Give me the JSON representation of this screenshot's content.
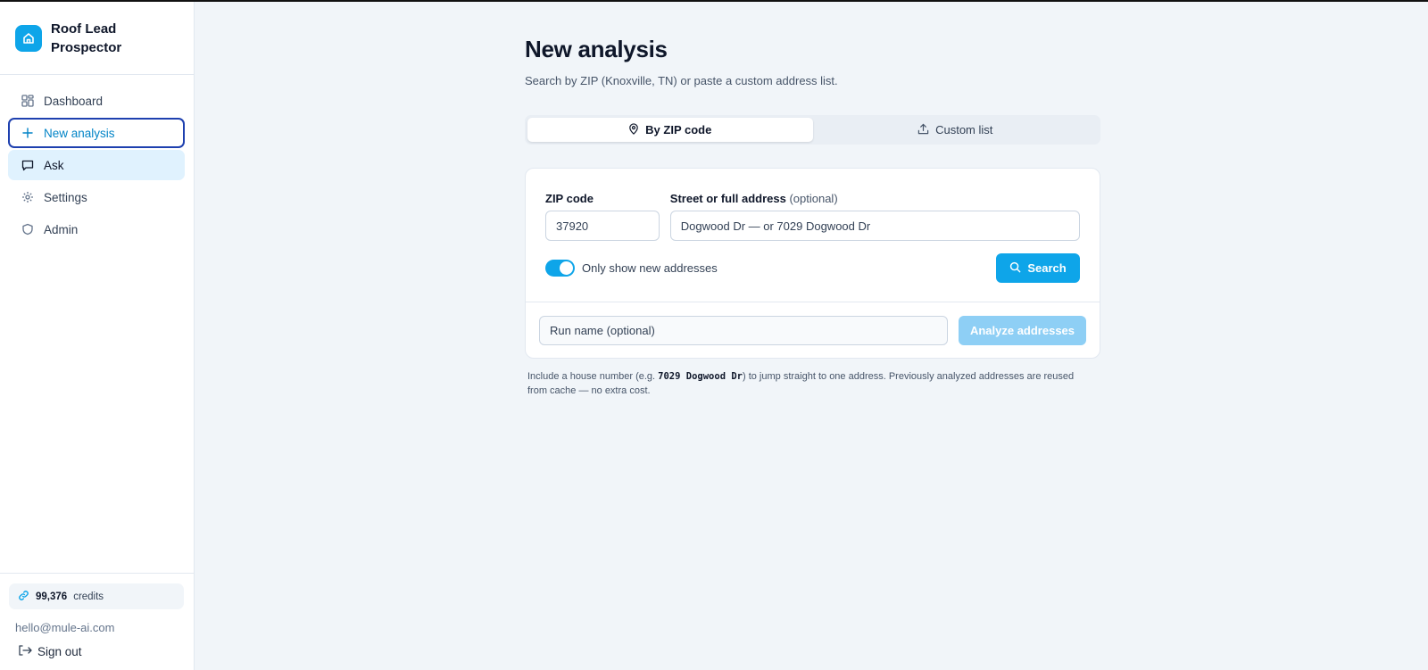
{
  "app": {
    "name": "Roof Lead Prospector"
  },
  "sidebar": {
    "items": [
      {
        "label": "Dashboard",
        "icon": "grid-icon"
      },
      {
        "label": "New analysis",
        "icon": "plus-icon"
      },
      {
        "label": "Ask",
        "icon": "chat-icon"
      },
      {
        "label": "Settings",
        "icon": "gear-icon"
      },
      {
        "label": "Admin",
        "icon": "shield-icon"
      }
    ],
    "credits_value": "99,376",
    "credits_label": "credits",
    "email": "hello@mule-ai.com",
    "signout": "Sign out"
  },
  "page": {
    "title": "New analysis",
    "subtitle": "Search by ZIP (Knoxville, TN) or paste a custom address list."
  },
  "tabs": [
    {
      "label": "By ZIP code",
      "icon": "map-pin-icon",
      "active": true
    },
    {
      "label": "Custom list",
      "icon": "upload-icon",
      "active": false
    }
  ],
  "form": {
    "zip_label": "ZIP code",
    "zip_value": "37920",
    "address_label": "Street or full address",
    "address_optional": "(optional)",
    "address_placeholder": "Dogwood Dr  —  or  7029 Dogwood Dr",
    "toggle_label": "Only show new addresses",
    "toggle_on": true,
    "search_button": "Search",
    "run_name_placeholder": "Run name (optional)",
    "analyze_button": "Analyze addresses"
  },
  "help": {
    "before": "Include a house number (e.g. ",
    "code": "7029 Dogwood Dr",
    "after": ") to jump straight to one address. Previously analyzed addresses are reused from cache — no extra cost."
  },
  "colors": {
    "accent": "#0ea5e9",
    "accent_disabled": "#8ecff5",
    "active_nav_bg": "#e0f2fe",
    "focus_ring": "#1e40af"
  }
}
